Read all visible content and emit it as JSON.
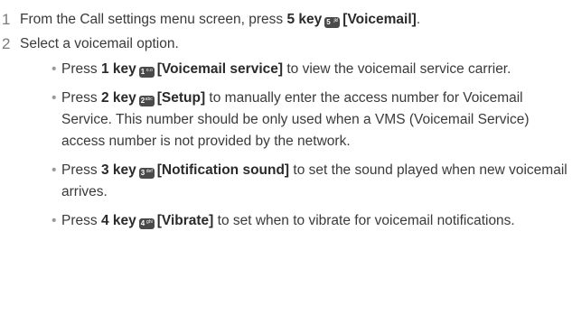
{
  "steps": [
    {
      "number": "1",
      "pre": "From the Call settings menu screen, press ",
      "key": "5 key",
      "icon_digit": "5",
      "icon_letters": "jkl",
      "label": "[Voicemail]",
      "post": "."
    },
    {
      "number": "2",
      "text": "Select a voicemail option."
    }
  ],
  "options": [
    {
      "pre": "Press ",
      "key": "1 key",
      "icon_digit": "1",
      "icon_letters": "o.o",
      "label": "[Voicemail service]",
      "post": " to view the voicemail service carrier."
    },
    {
      "pre": "Press ",
      "key": "2 key",
      "icon_digit": "2",
      "icon_letters": "abc",
      "label": "[Setup]",
      "post": " to manually enter the access number for Voicemail Service. This number should be only used when a VMS (Voicemail Service) access number is not provided by the network."
    },
    {
      "pre": "Press ",
      "key": "3 key",
      "icon_digit": "3",
      "icon_letters": "def",
      "label": "[Notification sound]",
      "post": " to set the sound played when new voicemail arrives."
    },
    {
      "pre": "Press ",
      "key": "4 key",
      "icon_digit": "4",
      "icon_letters": "ghi",
      "label": "[Vibrate]",
      "post": " to set when to vibrate for voicemail notifications."
    }
  ],
  "bullet_char": "•"
}
